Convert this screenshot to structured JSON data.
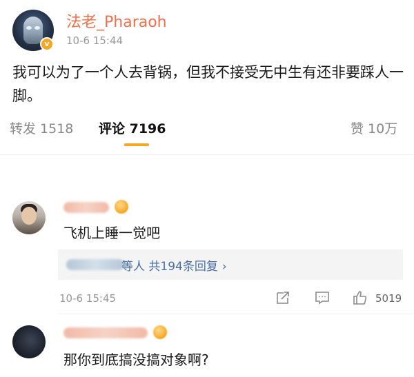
{
  "post": {
    "username": "法老_Pharaoh",
    "time": "10-6 15:44",
    "verified_badge": "v",
    "text": "我可以为了一个人去背锅，但我不接受无中生有还非要踩人一脚。"
  },
  "tabs": {
    "repost": "转发 1518",
    "comment": "评论 7196",
    "like": "赞 10万"
  },
  "comments": [
    {
      "text": "飞机上睡一觉吧",
      "replies_label": "等人 共194条回复",
      "replies_chevron": "›",
      "time": "10-6 15:45",
      "like_count": "5019"
    },
    {
      "text": "那你到底搞没搞对象啊?"
    }
  ],
  "colors": {
    "username": "#eb7350",
    "accent": "#f5a623",
    "link": "#4a6fa5",
    "muted": "#999999"
  },
  "icons": [
    "share-icon",
    "comment-icon",
    "like-icon",
    "verified-badge-icon"
  ]
}
